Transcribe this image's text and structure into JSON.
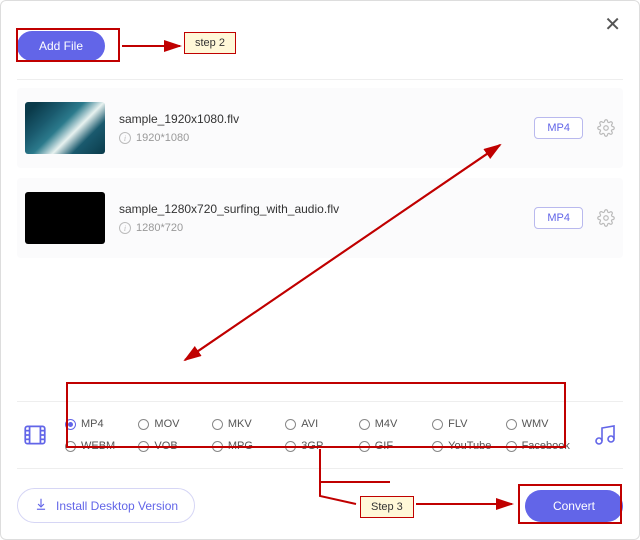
{
  "header": {
    "add_file_label": "Add File"
  },
  "annotations": {
    "step2": "step 2",
    "step3": "Step 3"
  },
  "files": [
    {
      "name": "sample_1920x1080.flv",
      "resolution": "1920*1080",
      "format_label": "MP4"
    },
    {
      "name": "sample_1280x720_surfing_with_audio.flv",
      "resolution": "1280*720",
      "format_label": "MP4"
    }
  ],
  "formats": {
    "row1": [
      "MP4",
      "MOV",
      "MKV",
      "AVI",
      "M4V",
      "FLV",
      "WMV"
    ],
    "row2": [
      "WEBM",
      "VOB",
      "MPG",
      "3GP",
      "GIF",
      "YouTube",
      "Facebook"
    ],
    "selected": "MP4"
  },
  "footer": {
    "install_label": "Install Desktop Version",
    "convert_label": "Convert"
  }
}
